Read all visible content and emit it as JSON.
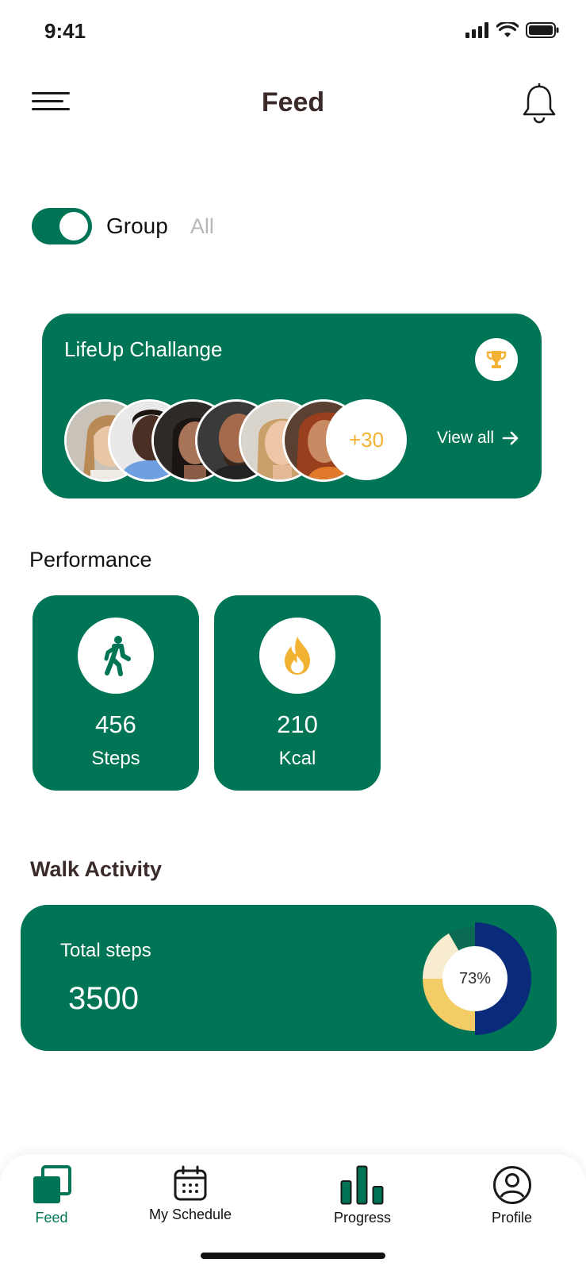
{
  "status_bar": {
    "time": "9:41"
  },
  "header": {
    "title": "Feed",
    "menu_icon": "hamburger-icon",
    "notification_icon": "bell-icon"
  },
  "filter": {
    "toggle_on": true,
    "primary_label": "Group",
    "secondary_label": "All"
  },
  "challenge": {
    "title": "LifeUp Challange",
    "trophy_icon": "trophy-icon",
    "extra_participants": "+30",
    "view_all_label": "View all",
    "participants_shown": 6
  },
  "performance": {
    "title": "Performance",
    "cards": [
      {
        "value": "456",
        "label": "Steps",
        "icon": "walking-icon"
      },
      {
        "value": "210",
        "label": "Kcal",
        "icon": "flame-icon"
      }
    ]
  },
  "walk_activity": {
    "title": "Walk Activity",
    "total_label": "Total steps",
    "total_value": "3500",
    "progress_label": "73%",
    "progress_fraction": 0.73
  },
  "nav": {
    "items": [
      {
        "label": "Feed",
        "icon": "feed-icon",
        "active": true
      },
      {
        "label": "My Schedule",
        "icon": "calendar-icon",
        "active": false
      },
      {
        "label": "Progress",
        "icon": "bar-chart-icon",
        "active": false
      },
      {
        "label": "Profile",
        "icon": "profile-icon",
        "active": false
      }
    ]
  },
  "colors": {
    "primary_green": "#007556",
    "accent_yellow": "#f2b233",
    "donut_navy": "#0a2a7a",
    "title_brown": "#3b2a2a"
  }
}
